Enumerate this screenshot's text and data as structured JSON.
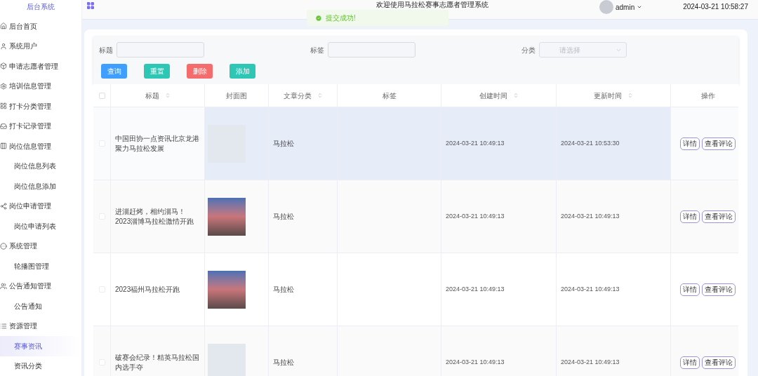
{
  "sidebar": {
    "title": "后台系统",
    "items": [
      {
        "label": "后台首页",
        "selected": false
      },
      {
        "label": "系统用户",
        "selected": false
      },
      {
        "label": "申请志愿者管理",
        "selected": false
      },
      {
        "label": "培训信息管理",
        "selected": false
      },
      {
        "label": "打卡分类管理",
        "selected": false
      },
      {
        "label": "打卡记录管理",
        "selected": false
      },
      {
        "label": "岗位信息管理",
        "selected": false,
        "children": [
          {
            "label": "岗位信息列表",
            "selected": false
          },
          {
            "label": "岗位信息添加",
            "selected": false
          }
        ]
      },
      {
        "label": "岗位申请管理",
        "selected": false,
        "children": [
          {
            "label": "岗位申请列表",
            "selected": false
          }
        ]
      },
      {
        "label": "系统管理",
        "selected": false,
        "children": [
          {
            "label": "轮播图管理",
            "selected": false
          }
        ]
      },
      {
        "label": "公告通知管理",
        "selected": false,
        "children": [
          {
            "label": "公告通知",
            "selected": false
          }
        ]
      },
      {
        "label": "资源管理",
        "selected": false,
        "children": [
          {
            "label": "赛事资讯",
            "selected": true
          },
          {
            "label": "资讯分类",
            "selected": false
          }
        ]
      }
    ]
  },
  "header": {
    "title": "欢迎使用马拉松赛事志愿者管理系统",
    "user": "admin",
    "datetime": "2024-03-21 10:58:27"
  },
  "toast": {
    "message": "提交成功!"
  },
  "filters": [
    {
      "label": "标题",
      "kind": "input"
    },
    {
      "label": "标签",
      "kind": "input"
    },
    {
      "label": "分类",
      "kind": "select",
      "placeholder": "请选择"
    }
  ],
  "buttons": [
    {
      "label": "查询",
      "color": "#409eff"
    },
    {
      "label": "重置",
      "color": "#2ec7b5"
    },
    {
      "label": "删除",
      "color": "#f56c6c"
    },
    {
      "label": "添加",
      "color": "#2ec7b5"
    }
  ],
  "table": {
    "select_all": {
      "checked": false
    },
    "columns": [
      {
        "label": "标题",
        "sortable": true
      },
      {
        "label": "封面图",
        "sortable": false
      },
      {
        "label": "文章分类",
        "sortable": true
      },
      {
        "label": "标签",
        "sortable": false
      },
      {
        "label": "创建时间",
        "sortable": true
      },
      {
        "label": "更新时间",
        "sortable": true
      },
      {
        "label": "操作",
        "sortable": false
      }
    ],
    "rows": [
      {
        "kind": "blank-cover",
        "checked": false,
        "selected": true,
        "title": "中国田协一点资讯北京龙港聚力马拉松发展",
        "category": "马拉松",
        "created": "2024-03-21 10:49:13",
        "updated": "2024-03-21 10:53:30",
        "actions": [
          "详情",
          "查看评论"
        ]
      },
      {
        "kind": "photo-cover",
        "checked": false,
        "selected": false,
        "title": "进淄赶烤，相约淄马！2023淄博马拉松激情开跑",
        "category": "马拉松",
        "created": "2024-03-21 10:49:13",
        "updated": "2024-03-21 10:49:13",
        "actions": [
          "详情",
          "查看评论"
        ]
      },
      {
        "kind": "photo-cover",
        "checked": false,
        "selected": false,
        "title": "2023福州马拉松开跑",
        "category": "马拉松",
        "created": "2024-03-21 10:49:13",
        "updated": "2024-03-21 10:49:13",
        "actions": [
          "详情",
          "查看评论"
        ]
      },
      {
        "kind": "blank-cover",
        "checked": false,
        "selected": false,
        "title": "破赛会纪录！精英马拉松国内选手夺",
        "category": "马拉松",
        "created": "2024-03-21 10:49:13",
        "updated": "2024-03-21 10:49:13",
        "actions": [
          "详情",
          "查看评论"
        ]
      }
    ]
  }
}
